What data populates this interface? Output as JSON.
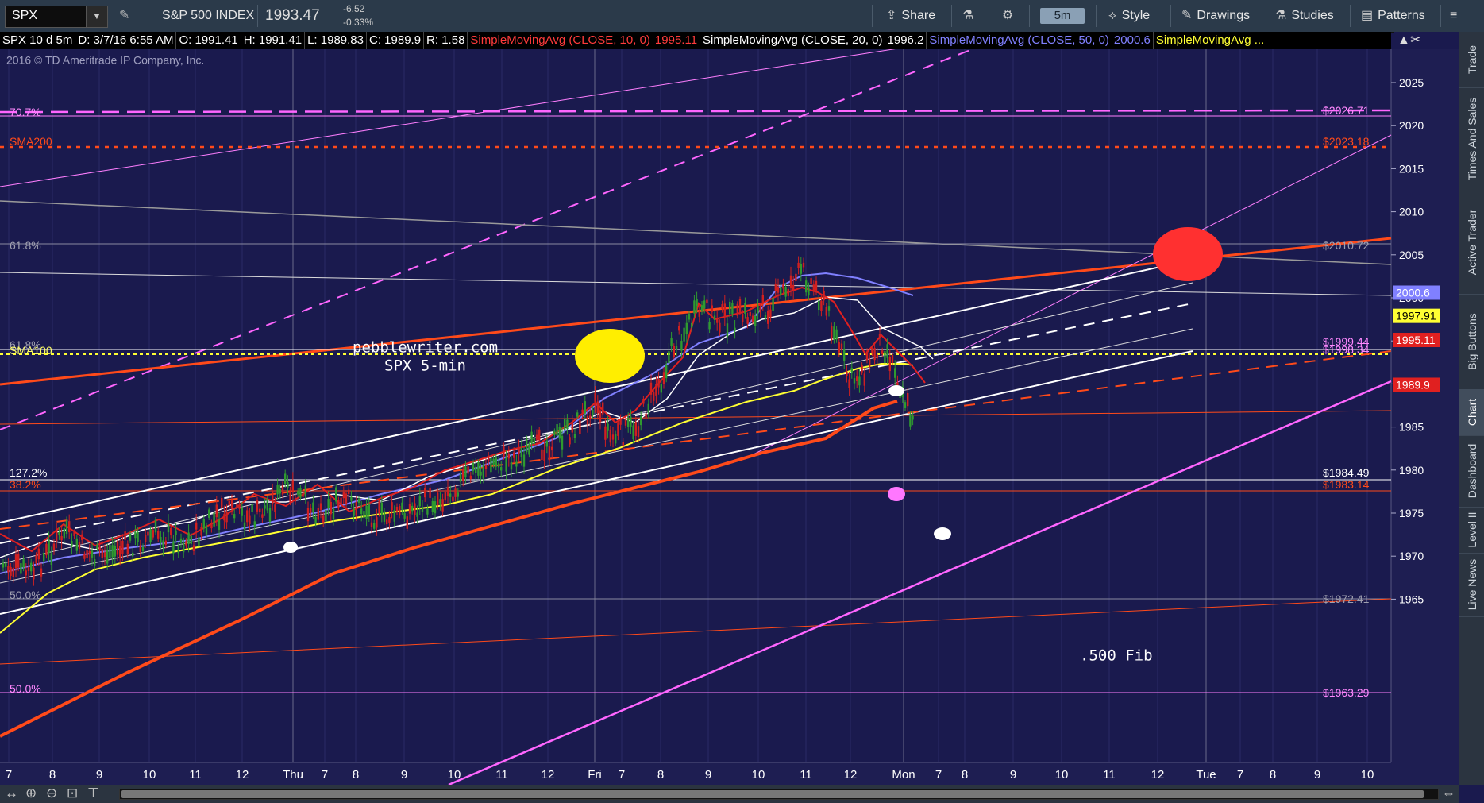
{
  "toolbar": {
    "symbol": "SPX",
    "instrument": "S&P 500 INDEX",
    "price": "1993.47",
    "change": "-6.52",
    "change_pct": "-0.33%",
    "share": "Share",
    "timeframe": "5m",
    "style": "Style",
    "drawings": "Drawings",
    "studies": "Studies",
    "patterns": "Patterns"
  },
  "legend": {
    "symbol_period": "SPX 10 d 5m",
    "date": "D: 3/7/16 6:55 AM",
    "open": "O: 1991.41",
    "high": "H: 1991.41",
    "low": "L: 1989.83",
    "close": "C: 1989.9",
    "range": "R: 1.58",
    "sma10_label": "SimpleMovingAvg (CLOSE, 10, 0)",
    "sma10_value": "1995.11",
    "sma20_label": "SimpleMovingAvg (CLOSE, 20, 0)",
    "sma20_value": "1996.2",
    "sma50_label": "SimpleMovingAvg (CLOSE, 50, 0)",
    "sma50_value": "2000.6",
    "sma_more": "SimpleMovingAvg ...",
    "colors": {
      "sma10": "#ff3b3b",
      "sma20": "#ffffff",
      "sma50": "#8080ff",
      "sma_more": "#ffff33"
    }
  },
  "chart": {
    "copyright": "2016 © TD Ameritrade IP Company, Inc.",
    "watermark_site": "pebblewriter.com",
    "watermark_desc": "SPX 5-min",
    "fib_note": ".500 Fib",
    "y_ticks": [
      "2025",
      "2020",
      "2015",
      "2010",
      "2005",
      "2000",
      "1995",
      "1990",
      "1985",
      "1980",
      "1975",
      "1970",
      "1965"
    ],
    "x_ticks": [
      "7",
      "8",
      "9",
      "10",
      "11",
      "12",
      "Thu",
      "7",
      "8",
      "9",
      "10",
      "11",
      "12",
      "Fri",
      "7",
      "8",
      "9",
      "10",
      "11",
      "12",
      "Mon",
      "7",
      "8",
      "9",
      "10",
      "11",
      "12",
      "Tue",
      "7",
      "8",
      "9",
      "10"
    ],
    "left_labels": [
      "70.7%",
      "SMA200",
      "61.8%",
      "61.8%",
      "SMA100",
      "127.2%",
      "38.2%",
      "50.0%",
      "50.0%"
    ],
    "level_labels": [
      "$2026.71",
      "$2023.18",
      "$2010.72",
      "$1999.44",
      "$1998.34",
      "$1984.49",
      "$1983.14",
      "$1972.41",
      "$1963.29"
    ],
    "price_tags": [
      {
        "value": "2000.6",
        "bg": "#8080ff",
        "fg": "#ffffff"
      },
      {
        "value": "1997.91",
        "bg": "#ffff33",
        "fg": "#000000"
      },
      {
        "value": "1995.11",
        "bg": "#e02020",
        "fg": "#ffffff"
      },
      {
        "value": "1989.9",
        "bg": "#e02020",
        "fg": "#ffffff"
      }
    ],
    "colors": {
      "background": "#1a1a4e",
      "candle_up": "#2f9a2f",
      "candle_down": "#d02020",
      "orange": "#ff4a1a",
      "magenta": "#ff66ff",
      "yellow": "#ffff33"
    }
  },
  "right_tabs": [
    "Trade",
    "Times And Sales",
    "Active Trader",
    "Big Buttons",
    "Chart",
    "Dashboard",
    "Level II",
    "Live News"
  ]
}
